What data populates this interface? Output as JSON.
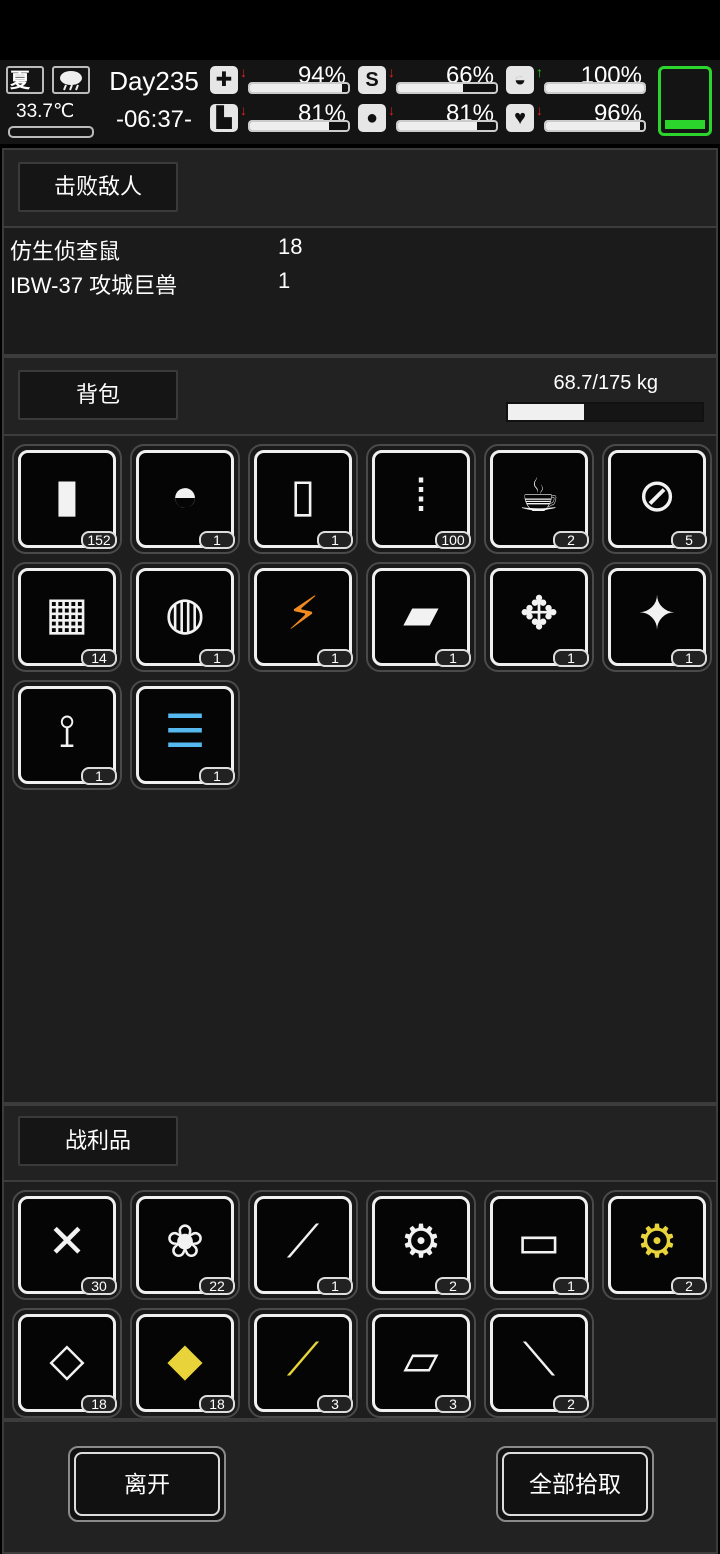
{
  "hud": {
    "season": "夏",
    "weather_icon": "rain-cloud-icon",
    "temperature": "33.7℃",
    "day": "Day235",
    "time": "-06:37-",
    "stats": [
      {
        "id": "health",
        "icon": "medkit-icon",
        "glyph": "✚",
        "trend": "down",
        "pct_text": "94%",
        "value": 0.94
      },
      {
        "id": "stomach",
        "icon": "stomach-icon",
        "glyph": "S",
        "trend": "down",
        "pct_text": "66%",
        "value": 0.66
      },
      {
        "id": "mind",
        "icon": "brain-icon",
        "glyph": "◒",
        "trend": "up",
        "pct_text": "100%",
        "value": 1.0
      },
      {
        "id": "stamina",
        "icon": "boot-icon",
        "glyph": "▙",
        "trend": "down",
        "pct_text": "81%",
        "value": 0.81
      },
      {
        "id": "water",
        "icon": "water-drop-icon",
        "glyph": "●",
        "trend": "down",
        "pct_text": "81%",
        "value": 0.81
      },
      {
        "id": "mood",
        "icon": "heart-icon",
        "glyph": "♥",
        "trend": "down",
        "pct_text": "96%",
        "value": 0.96
      }
    ],
    "battery_level": 0.15
  },
  "defeated": {
    "title": "击败敌人",
    "enemies": [
      {
        "name": "仿生侦查鼠",
        "count": "18"
      },
      {
        "name": "IBW-37 攻城巨兽",
        "count": "1"
      }
    ]
  },
  "backpack": {
    "title": "背包",
    "weight_text": "68.7/175 kg",
    "weight_ratio": 0.3926,
    "items": [
      {
        "icon": "battery-icon",
        "glyph": "▮",
        "tint": "",
        "count": "152"
      },
      {
        "icon": "rice-bowl-icon",
        "glyph": "◓",
        "tint": "",
        "count": "1"
      },
      {
        "icon": "water-bottle-icon",
        "glyph": "▯",
        "tint": "",
        "count": "1"
      },
      {
        "icon": "bullets-icon",
        "glyph": "⁞",
        "tint": "",
        "count": "100"
      },
      {
        "icon": "coffee-cup-icon",
        "glyph": "☕",
        "tint": "",
        "count": "2"
      },
      {
        "icon": "glass-bottle-icon",
        "glyph": "⊘",
        "tint": "",
        "count": "5"
      },
      {
        "icon": "net-trap-icon",
        "glyph": "▦",
        "tint": "",
        "count": "14"
      },
      {
        "icon": "tactical-helmet-icon",
        "glyph": "◍",
        "tint": "",
        "count": "1"
      },
      {
        "icon": "tesla-staff-icon",
        "glyph": "⚡",
        "tint": "orange",
        "count": "1"
      },
      {
        "icon": "armor-plate-icon",
        "glyph": "▰",
        "tint": "",
        "count": "1"
      },
      {
        "icon": "mech-arm-parts-icon",
        "glyph": "✥",
        "tint": "",
        "count": "1"
      },
      {
        "icon": "mech-chassis-icon",
        "glyph": "✦",
        "tint": "",
        "count": "1"
      },
      {
        "icon": "robotic-arm-icon",
        "glyph": "⟟",
        "tint": "",
        "count": "1"
      },
      {
        "icon": "gatling-gun-icon",
        "glyph": "☰",
        "tint": "blue",
        "count": "1"
      }
    ]
  },
  "loot": {
    "title": "战利品",
    "items": [
      {
        "icon": "screws-icon",
        "glyph": "✕",
        "tint": "",
        "count": "30"
      },
      {
        "icon": "cotton-icon",
        "glyph": "❀",
        "tint": "",
        "count": "22"
      },
      {
        "icon": "wires-icon",
        "glyph": "⟋",
        "tint": "",
        "count": "1"
      },
      {
        "icon": "electronic-parts-icon",
        "glyph": "⚙",
        "tint": "",
        "count": "2"
      },
      {
        "icon": "metal-ingot-icon",
        "glyph": "▭",
        "tint": "",
        "count": "1"
      },
      {
        "icon": "gold-electronic-parts-icon",
        "glyph": "⚙",
        "tint": "gold",
        "count": "2"
      },
      {
        "icon": "plastic-sheet-icon",
        "glyph": "◇",
        "tint": "",
        "count": "18"
      },
      {
        "icon": "gold-plate-icon",
        "glyph": "◆",
        "tint": "gold",
        "count": "18"
      },
      {
        "icon": "gold-wires-icon",
        "glyph": "⟋",
        "tint": "gold",
        "count": "3"
      },
      {
        "icon": "glass-pane-icon",
        "glyph": "▱",
        "tint": "",
        "count": "3"
      },
      {
        "icon": "pipe-part-icon",
        "glyph": "⟍",
        "tint": "",
        "count": "2"
      }
    ]
  },
  "footer": {
    "leave_label": "离开",
    "take_all_label": "全部拾取"
  }
}
